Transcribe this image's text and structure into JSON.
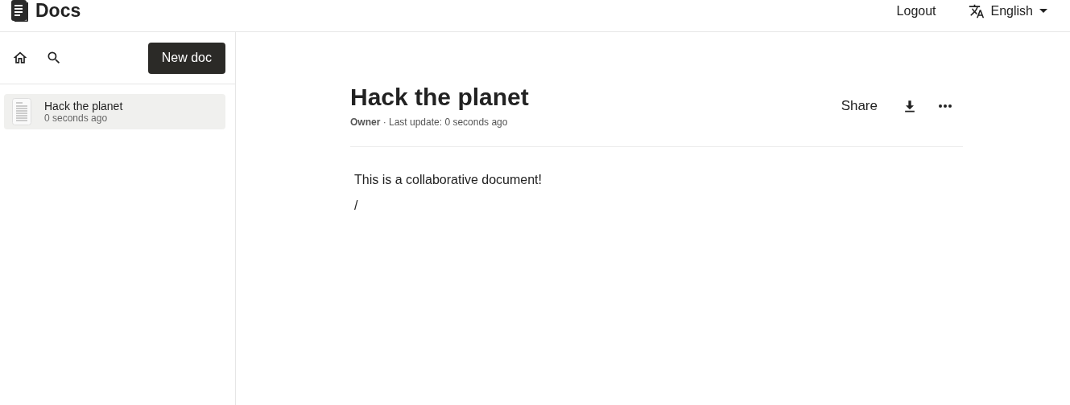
{
  "header": {
    "logo": "Docs",
    "logout": "Logout",
    "language": "English"
  },
  "sidebar": {
    "new_button": "New doc",
    "items": [
      {
        "title": "Hack the planet",
        "subtitle": "0 seconds ago",
        "selected": true
      }
    ]
  },
  "document": {
    "title": "Hack the planet",
    "meta": "**Owner** · Last update: 0 seconds ago",
    "share": "Share",
    "paragraphs": [
      "This is a collaborative document!",
      "/"
    ]
  }
}
